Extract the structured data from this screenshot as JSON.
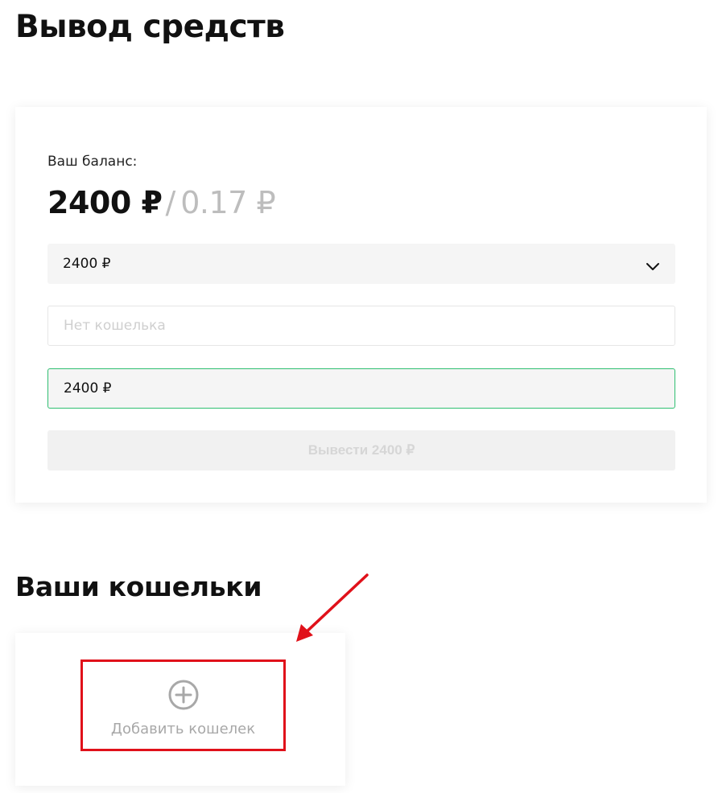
{
  "page": {
    "title": "Вывод средств"
  },
  "withdraw": {
    "balance_label": "Ваш баланс:",
    "balance_main": "2400 ₽",
    "balance_separator": "/",
    "balance_secondary": "0.17 ₽",
    "currency_select": {
      "selected": "2400 ₽",
      "icon": "chevron-down-icon"
    },
    "wallet_input": {
      "placeholder": "Нет кошелька",
      "value": ""
    },
    "amount_input": {
      "value": "2400 ₽"
    },
    "submit_label": "Вывести 2400 ₽"
  },
  "wallets": {
    "title": "Ваши кошельки",
    "add_label": "Добавить кошелек",
    "add_icon": "plus-circle-icon"
  },
  "colors": {
    "accent_green": "#2fbf71",
    "annotation_red": "#e0111a",
    "muted_text": "#bdbdbd"
  }
}
